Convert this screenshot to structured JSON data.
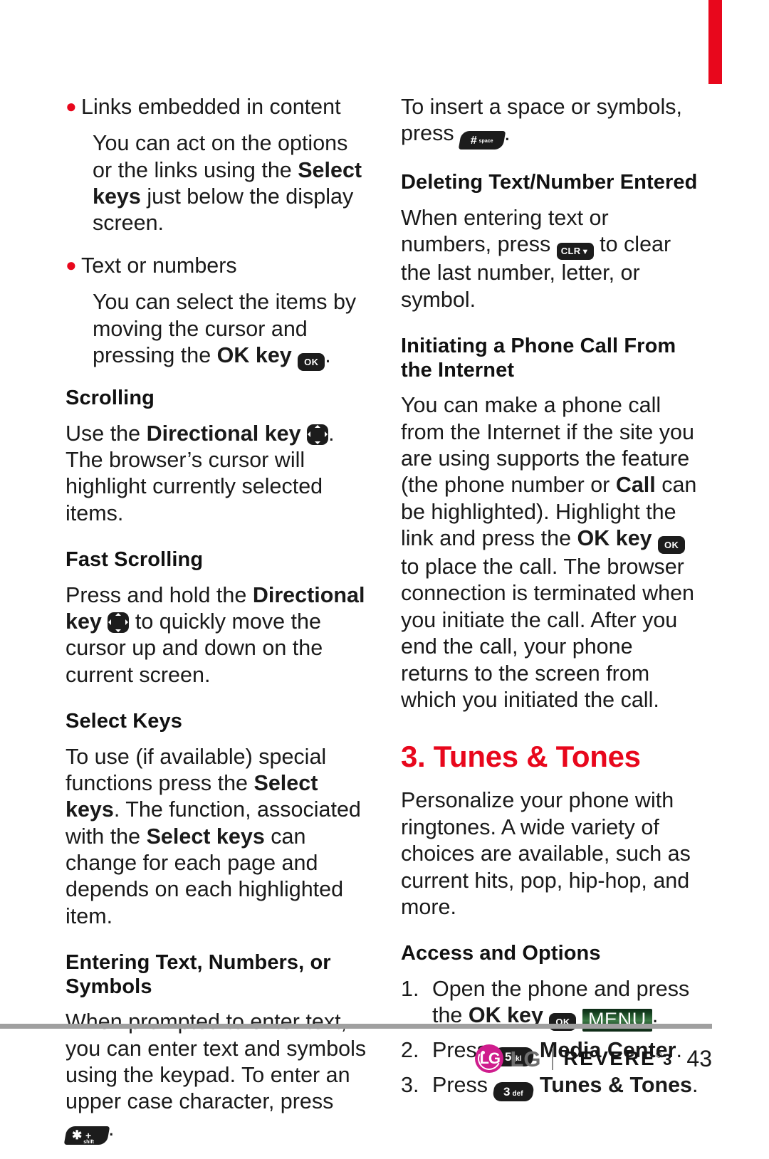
{
  "page": {
    "number": "43",
    "accent_red": "#e8071c",
    "footer_rule_color": "#a0a0a0"
  },
  "footer": {
    "lg_letters": "LG",
    "lg_word": "LG",
    "product": "REVERE",
    "product_registered": "®",
    "product_number": "3",
    "page_number": "43"
  },
  "left_column": {
    "bullet1": {
      "label": "Links embedded in content",
      "body_1": "You can act on the options or the links using the ",
      "body_bold": "Select keys",
      "body_2": " just below the display screen."
    },
    "bullet2": {
      "label": "Text or numbers",
      "body_1": "You can select the items by moving the cursor and pressing the ",
      "body_bold": "OK key",
      "body_2": " ",
      "key_icon": "ok-key-icon",
      "key_label": "OK",
      "body_3": "."
    },
    "scrolling": {
      "heading": "Scrolling",
      "body_1": "Use the ",
      "body_bold": "Directional key",
      "key_icon": "directional-key-icon",
      "body_2": ". The browser’s cursor will highlight currently selected items."
    },
    "fast_scrolling": {
      "heading": "Fast Scrolling",
      "body_1": "Press and hold the ",
      "body_bold": "Directional key",
      "key_icon": "directional-key-icon",
      "body_2": " to quickly move the cursor up and down on the current screen."
    },
    "select_keys": {
      "heading": "Select Keys",
      "body_1": "To use (if available) special functions press the ",
      "body_bold_1": "Select keys",
      "body_2": ". The function, associated with the ",
      "body_bold_2": "Select keys",
      "body_3": " can change for each page and depends on each highlighted item."
    },
    "entering_text": {
      "heading": "Entering Text, Numbers, or Symbols",
      "body_1": "When prompted to enter text, you can enter text and symbols using the keypad. To enter an upper case character, press ",
      "key_icon": "star-shift-key-icon",
      "key_star": "✱",
      "key_plus": "+",
      "key_shift": "shift",
      "body_2": "."
    }
  },
  "right_column": {
    "insert_space": {
      "body_1": "To insert a space or symbols, press ",
      "key_icon": "hash-space-key-icon",
      "key_hash": "#",
      "key_sub": "space",
      "body_2": "."
    },
    "deleting": {
      "heading": "Deleting Text/Number Entered",
      "body_1": "When entering text or numbers, press ",
      "key_icon": "clr-key-icon",
      "key_label": "CLR",
      "key_arrow": "⬇",
      "body_2": " to clear the last number, letter, or symbol."
    },
    "initiating_call": {
      "heading": "Initiating a Phone Call From the Internet",
      "body_1": "You can make a phone call from the Internet if the site you are using supports the feature (the phone number or ",
      "body_bold_1": "Call",
      "body_2": " can be highlighted). Highlight the link and press the ",
      "body_bold_2": "OK key",
      "key_icon": "ok-key-icon",
      "key_label": "OK",
      "body_3": " to place the call. The browser connection is terminated when you initiate the call. After you end the call, your phone returns to the screen from which you initiated the call."
    },
    "chapter": {
      "title": "3. Tunes & Tones",
      "body": "Personalize your phone with ringtones.  A wide variety of choices are available, such as current hits, pop, hip-hop, and more."
    },
    "access_options": {
      "heading": "Access and Options",
      "steps": [
        {
          "marker": "1.",
          "body_1": "Open the phone and press the ",
          "body_bold": "OK key",
          "key_icon": "ok-key-icon",
          "key_label": "OK",
          "badge_icon": "menu-badge-icon",
          "badge_label": "MENU",
          "body_2": "."
        },
        {
          "marker": "2.",
          "body_1": "Press ",
          "key_icon": "number-5-key-icon",
          "key_digit": "5",
          "key_sub": "jkl",
          "body_bold": "Media Center",
          "body_2": "."
        },
        {
          "marker": "3.",
          "body_1": "Press ",
          "key_icon": "number-3-key-icon",
          "key_digit": "3",
          "key_sub": "def",
          "body_bold": "Tunes & Tones",
          "body_2": "."
        }
      ]
    }
  }
}
